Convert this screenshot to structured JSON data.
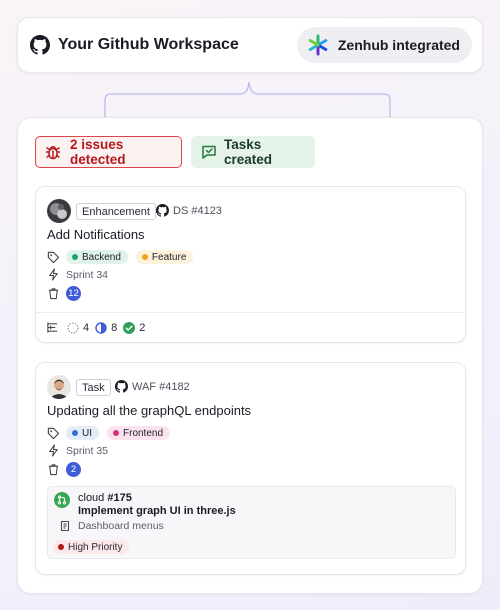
{
  "header": {
    "title": "Your Github Workspace",
    "integration_label": "Zenhub integrated"
  },
  "status": {
    "issues_label": "2 issues detected",
    "tasks_label": "Tasks created"
  },
  "issues": [
    {
      "type": "Enhancement",
      "ref": "DS #4123",
      "title": "Add Notifications",
      "labels": [
        {
          "name": "Backend",
          "bg": "#dff3ea",
          "dot": "#1fa36b"
        },
        {
          "name": "Feature",
          "bg": "#fdf3dc",
          "dot": "#f2a51a"
        }
      ],
      "sprint": "Sprint 34",
      "estimate": "12",
      "stats": {
        "open": "4",
        "in_progress": "8",
        "done": "2"
      }
    },
    {
      "type": "Task",
      "ref": "WAF #4182",
      "title": "Updating all the graphQL endpoints",
      "labels": [
        {
          "name": "UI",
          "bg": "#e3ecf7",
          "dot": "#2f6fd1"
        },
        {
          "name": "Frontend",
          "bg": "#fae3ee",
          "dot": "#d6317e"
        }
      ],
      "sprint": "Sprint 35",
      "estimate": "2",
      "linked": {
        "repo": "cloud",
        "number": "#175",
        "title": "Implement graph UI in three.js",
        "epic": "Dashboard menus",
        "priority": "High Priority"
      }
    }
  ],
  "colors": {
    "accent": "#3f5bd9",
    "danger": "#b3181c",
    "success": "#34a853",
    "connector": "#b9bde8"
  }
}
